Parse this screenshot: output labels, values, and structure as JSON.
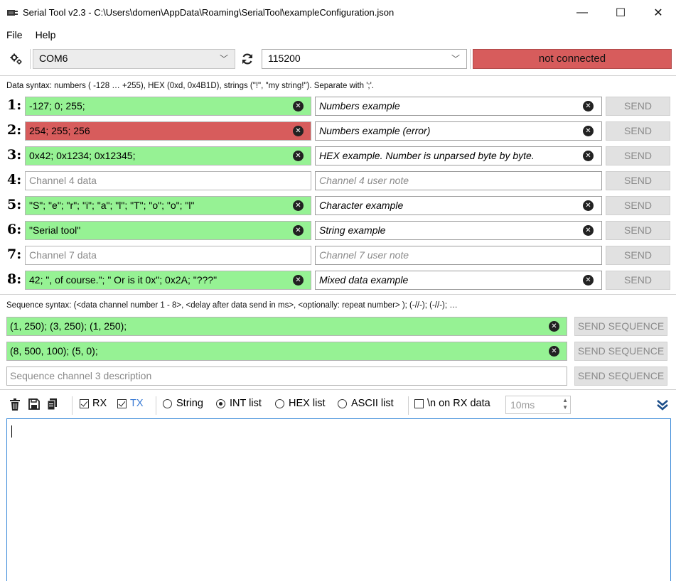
{
  "window": {
    "title": "Serial Tool v2.3 - C:\\Users\\domen\\AppData\\Roaming\\SerialTool\\exampleConfiguration.json",
    "minimize": "—",
    "maximize": "☐",
    "close": "✕"
  },
  "menu": {
    "file": "File",
    "help": "Help"
  },
  "connection": {
    "port": "COM6",
    "baud": "115200",
    "status": "not connected",
    "status_color": "#d75c5c"
  },
  "data_syntax": "Data syntax: numbers ( -128 … +255), HEX (0xd, 0x4B1D), strings (\"!\", \"my string!\"). Separate with ';'.",
  "channels": [
    {
      "num": "1:",
      "data": "-127; 0; 255;",
      "data_placeholder": "",
      "note": "Numbers example",
      "note_placeholder": "",
      "send": "SEND"
    },
    {
      "num": "2:",
      "data": "254; 255; 256",
      "data_placeholder": "",
      "note": "Numbers example (error)",
      "note_placeholder": "",
      "send": "SEND"
    },
    {
      "num": "3:",
      "data": "0x42; 0x1234; 0x12345;",
      "data_placeholder": "",
      "note": "HEX example. Number is unparsed byte by byte.",
      "note_placeholder": "",
      "send": "SEND"
    },
    {
      "num": "4:",
      "data": "",
      "data_placeholder": "Channel 4 data",
      "note": "",
      "note_placeholder": "Channel 4 user note",
      "send": "SEND"
    },
    {
      "num": "5:",
      "data": "\"S\"; \"e\"; \"r\"; \"i\"; \"a\"; \"l\"; \"T\"; \"o\"; \"o\"; \"l\"",
      "data_placeholder": "",
      "note": "Character example",
      "note_placeholder": "",
      "send": "SEND"
    },
    {
      "num": "6:",
      "data": "\"Serial tool\"",
      "data_placeholder": "",
      "note": "String example",
      "note_placeholder": "",
      "send": "SEND"
    },
    {
      "num": "7:",
      "data": "",
      "data_placeholder": "Channel 7 data",
      "note": "",
      "note_placeholder": "Channel 7 user note",
      "send": "SEND"
    },
    {
      "num": "8:",
      "data": "42; \", of course.\"; \" Or is it 0x\"; 0x2A; \"???\"",
      "data_placeholder": "",
      "note": "Mixed data example",
      "note_placeholder": "",
      "send": "SEND"
    }
  ],
  "sequence_syntax": "Sequence syntax: (<data channel number 1 - 8>, <delay after data send in ms>, <optionally: repeat number> ); (-//-); (-//-); …",
  "sequences": [
    {
      "data": "(1, 250); (3, 250); (1, 250);",
      "placeholder": "",
      "button": "SEND SEQUENCE"
    },
    {
      "data": "(8, 500, 100); (5, 0);",
      "placeholder": "",
      "button": "SEND SEQUENCE"
    },
    {
      "data": "",
      "placeholder": "Sequence channel 3 description",
      "button": "SEND SEQUENCE"
    }
  ],
  "log_toolbar": {
    "rx_label": "RX",
    "tx_label": "TX",
    "rx_checked": true,
    "tx_checked": true,
    "format_string": "String",
    "format_int": "INT list",
    "format_hex": "HEX list",
    "format_ascii": "ASCII list",
    "selected_format": "INT list",
    "newline_label": "\\n on RX data",
    "newline_checked": false,
    "timeout": "10ms"
  },
  "colors": {
    "valid_green": "#96f294",
    "error_red": "#d75c5c",
    "focus_blue": "#3b8ad9"
  }
}
